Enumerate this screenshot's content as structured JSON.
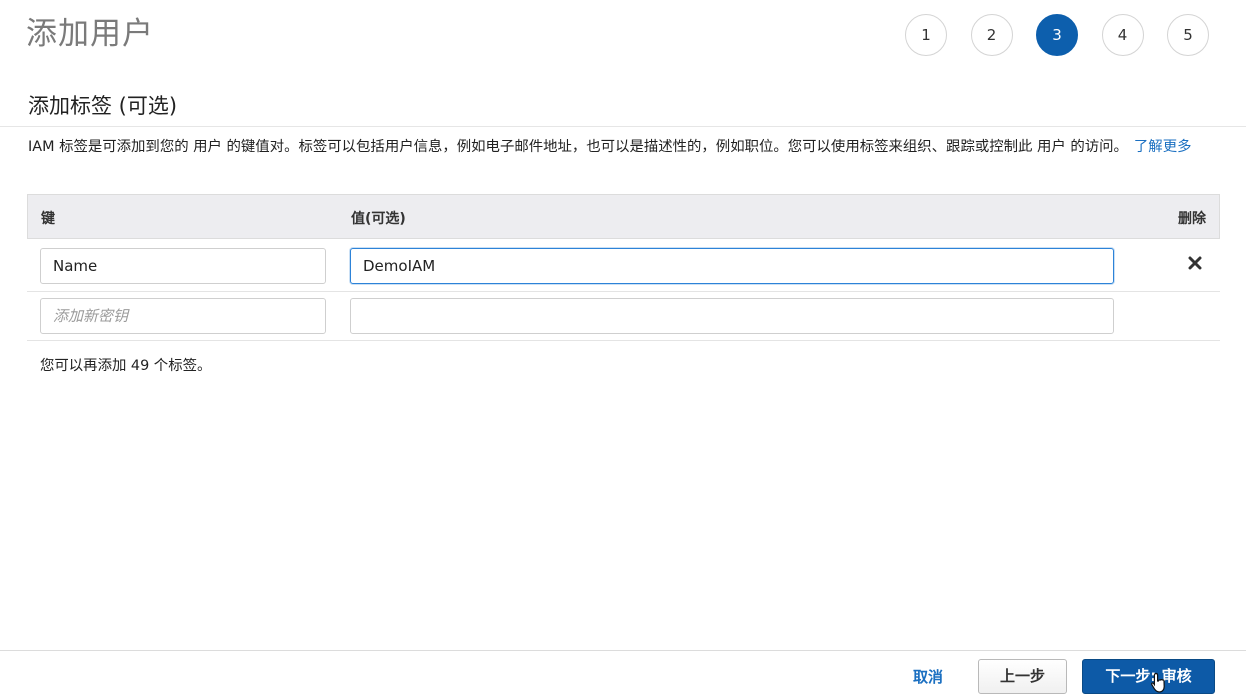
{
  "page": {
    "title": "添加用户"
  },
  "steps": [
    {
      "label": "1",
      "active": false
    },
    {
      "label": "2",
      "active": false
    },
    {
      "label": "3",
      "active": true
    },
    {
      "label": "4",
      "active": false
    },
    {
      "label": "5",
      "active": false
    }
  ],
  "section": {
    "title": "添加标签 (可选)",
    "description": "IAM 标签是可添加到您的 用户 的键值对。标签可以包括用户信息，例如电子邮件地址，也可以是描述性的，例如职位。您可以使用标签来组织、跟踪或控制此 用户 的访问。",
    "learn_more": "了解更多"
  },
  "table": {
    "headers": {
      "key": "键",
      "value": "值(可选)",
      "delete": "删除"
    },
    "rows": [
      {
        "key": "Name",
        "value": "DemoIAM"
      }
    ],
    "new_row": {
      "key_placeholder": "添加新密钥",
      "value_placeholder": ""
    },
    "delete_icon": "close-icon",
    "remaining_text": "您可以再添加 49 个标签。"
  },
  "footer": {
    "cancel_label": "取消",
    "previous_label": "上一步",
    "next_label": "下一步: 审核"
  },
  "colors": {
    "accent": "#0d5fad",
    "link": "#1a6fc1",
    "focus_border": "#2d83d8"
  }
}
